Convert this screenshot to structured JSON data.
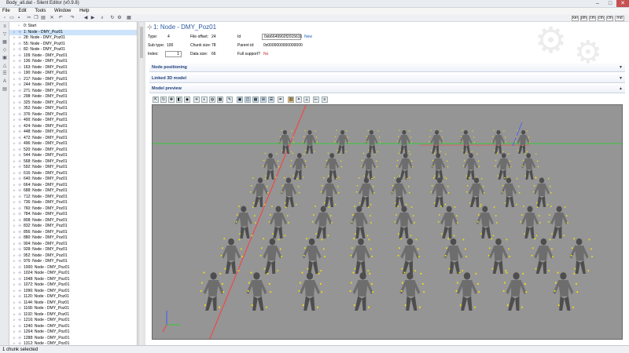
{
  "window": {
    "title": "Body_all.dat - Silent Editor (v0.9.8)",
    "min": "–",
    "max": "□",
    "close": "✕"
  },
  "menu": [
    "File",
    "Edit",
    "Tools",
    "Window",
    "Help"
  ],
  "toolbar": {
    "view_modes": [
      "kei",
      "pm",
      "cm",
      "cm",
      "cm",
      "rnd"
    ]
  },
  "tree": {
    "items": [
      "0: Start",
      "1: Node - DMY_Poz01",
      "28: Node - DMY_Poz01",
      "55: Node - DMY_Poz01",
      "82: Node - DMY_Poz01",
      "109: Node - DMY_Poz01",
      "136: Node - DMY_Poz01",
      "163: Node - DMY_Poz01",
      "190: Node - DMY_Poz01",
      "217: Node - DMY_Poz01",
      "244: Node - DMY_Poz01",
      "271: Node - DMY_Poz01",
      "298: Node - DMY_Poz01",
      "325: Node - DMY_Poz01",
      "352: Node - DMY_Poz01",
      "376: Node - DMY_Poz01",
      "400: Node - DMY_Poz01",
      "424: Node - DMY_Poz01",
      "448: Node - DMY_Poz01",
      "472: Node - DMY_Poz01",
      "496: Node - DMY_Poz01",
      "520: Node - DMY_Poz01",
      "544: Node - DMY_Poz01",
      "568: Node - DMY_Poz01",
      "592: Node - DMY_Poz01",
      "616: Node - DMY_Poz01",
      "640: Node - DMY_Poz01",
      "664: Node - DMY_Poz01",
      "688: Node - DMY_Poz01",
      "712: Node - DMY_Poz01",
      "736: Node - DMY_Poz01",
      "760: Node - DMY_Poz01",
      "784: Node - DMY_Poz01",
      "808: Node - DMY_Poz01",
      "832: Node - DMY_Poz01",
      "856: Node - DMY_Poz01",
      "880: Node - DMY_Poz01",
      "904: Node - DMY_Poz01",
      "928: Node - DMY_Poz01",
      "952: Node - DMY_Poz01",
      "976: Node - DMY_Poz01",
      "1000: Node - DMY_Poz01",
      "1024: Node - DMY_Poz01",
      "1048: Node - DMY_Poz01",
      "1072: Node - DMY_Poz01",
      "1096: Node - DMY_Poz01",
      "1120: Node - DMY_Poz01",
      "1144: Node - DMY_Poz01",
      "1168: Node - DMY_Poz01",
      "1192: Node - DMY_Poz01",
      "1216: Node - DMY_Poz01",
      "1240: Node - DMY_Poz01",
      "1264: Node - DMY_Poz01",
      "1288: Node - DMY_Poz01",
      "1312: Node - DMY_Poz01"
    ],
    "selected_index": 1
  },
  "node": {
    "heading": "1: Node - DMY_Poz01",
    "props": {
      "type_label": "Type:",
      "type_value": "4",
      "subtype_label": "Sub type:",
      "subtype_value": "100",
      "index_label": "Index:",
      "index_value": "1",
      "file_offset_label": "File offset:",
      "file_offset_value": "24",
      "chunk_size_label": "Chunk size:",
      "chunk_size_value": "78",
      "data_size_label": "Data size:",
      "data_size_value": "66",
      "id_label": "Id",
      "id_value": "0xb6649902f2015631",
      "id_link": "New",
      "parent_id_label": "Parent id:",
      "parent_id_value": "0x0000000000000000",
      "full_support_label": "Full support?",
      "full_support_value": "No"
    },
    "sections": [
      {
        "title": "Node positioning",
        "arrow": "▼"
      },
      {
        "title": "Linked 3D model",
        "arrow": "▼"
      },
      {
        "title": "Model preview",
        "arrow": "▲"
      }
    ]
  },
  "status": {
    "text": "1 chunk selected"
  },
  "colors": {
    "viewport_bg": "#959595",
    "axis_x": "#ff3b3b",
    "axis_y": "#36c83a",
    "axis_z": "#3a5cff",
    "marker": "#f5e400",
    "heading": "#2c5aa0"
  }
}
